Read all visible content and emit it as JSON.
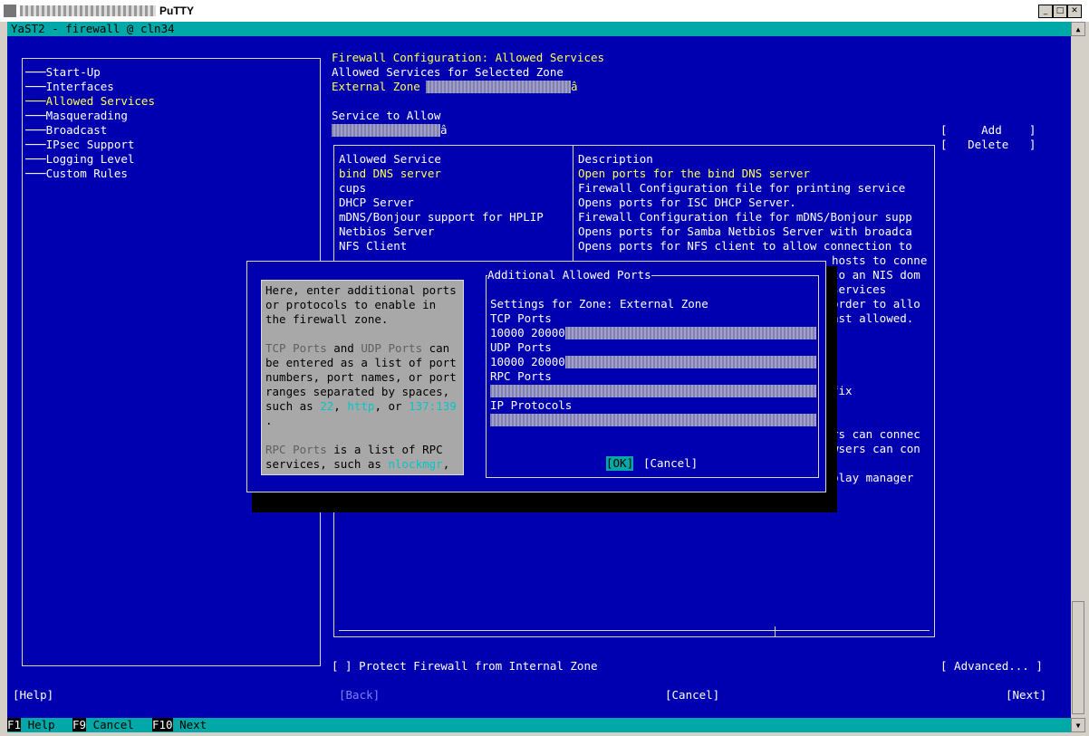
{
  "window": {
    "app_name": "PuTTY",
    "icon": "putty-icon",
    "controls": [
      "minimize-icon",
      "maximize-icon",
      "close-icon"
    ]
  },
  "terminal": {
    "header": "YaST2 - firewall @ cln34"
  },
  "nav": {
    "items": [
      {
        "label": "Start-Up"
      },
      {
        "label": "Interfaces"
      },
      {
        "label": "Allowed Services",
        "selected": true
      },
      {
        "label": "Masquerading"
      },
      {
        "label": "Broadcast"
      },
      {
        "label": "IPsec Support"
      },
      {
        "label": "Logging Level"
      },
      {
        "label": "Custom Rules"
      }
    ]
  },
  "main": {
    "title": "Firewall Configuration: Allowed Services",
    "subtitle": "Allowed Services for Selected Zone",
    "zone_label": "External Zone",
    "zone_arrow": "â",
    "service_label": "Service to Allow",
    "service_arrow": "â",
    "add_button": "[     Add    ]",
    "delete_button": "[   Delete   ]",
    "table": {
      "col_service": "Allowed Service",
      "col_description": "Description",
      "rows": [
        {
          "service": "bind DNS server",
          "description": "Open ports for the bind DNS server",
          "selected": true
        },
        {
          "service": "cups",
          "description": "Firewall Configuration file for printing service"
        },
        {
          "service": "DHCP Server",
          "description": "Opens ports for ISC DHCP Server."
        },
        {
          "service": "mDNS/Bonjour support for HPLIP",
          "description": "Firewall Configuration file for mDNS/Bonjour supp"
        },
        {
          "service": "Netbios Server",
          "description": "Opens ports for Samba Netbios Server with broadca"
        },
        {
          "service": "NFS Client",
          "description": "Opens ports for NFS client to allow connection to"
        }
      ],
      "partial_right": [
        "hosts to conne",
        "to an NIS dom",
        "services",
        "order to allo",
        "ast allowed.",
        "",
        "",
        "",
        "fix",
        "",
        "",
        "rs can connec",
        "wsers can con",
        "",
        "play manager"
      ]
    },
    "protect_checkbox": "[ ] Protect Firewall from Internal Zone",
    "advanced_button": "[ Advanced... ]"
  },
  "dialog": {
    "title": "Additional Allowed Ports",
    "settings_line": "Settings for Zone: External Zone",
    "tcp_label": "TCP Ports",
    "tcp_value": "10000 20000",
    "udp_label": "UDP Ports",
    "udp_value": "10000 20000",
    "rpc_label": "RPC Ports",
    "rpc_value": "",
    "ip_label": "IP Protocols",
    "ip_value": "",
    "ok_button": "[OK]",
    "cancel_button": "[Cancel]",
    "help": {
      "line1": "Here, enter additional ports",
      "line2": "or protocols to enable in",
      "line3": "the firewall zone.",
      "line5a": "TCP Ports",
      "line5b": " and ",
      "line5c": "UDP Ports",
      "line5d": " can",
      "line6": "be entered as a list of port",
      "line7": "numbers, port names, or port",
      "line8": "ranges separated by spaces,",
      "line9a": "such as ",
      "line9b": "22",
      "line9c": ", ",
      "line9d": "http",
      "line9e": ", or ",
      "line9f": "137:139",
      "line10": ".",
      "line12a": "RPC Ports",
      "line12b": " is a list of RPC",
      "line13a": "services, such as ",
      "line13b": "nlockmgr",
      "line13c": ","
    }
  },
  "footer": {
    "help": "[Help]",
    "back": "[Back]",
    "cancel": "[Cancel]",
    "next": "[Next]"
  },
  "fkeys": [
    {
      "key": "F1",
      "label": "Help"
    },
    {
      "key": "F9",
      "label": "Cancel"
    },
    {
      "key": "F10",
      "label": "Next"
    }
  ]
}
